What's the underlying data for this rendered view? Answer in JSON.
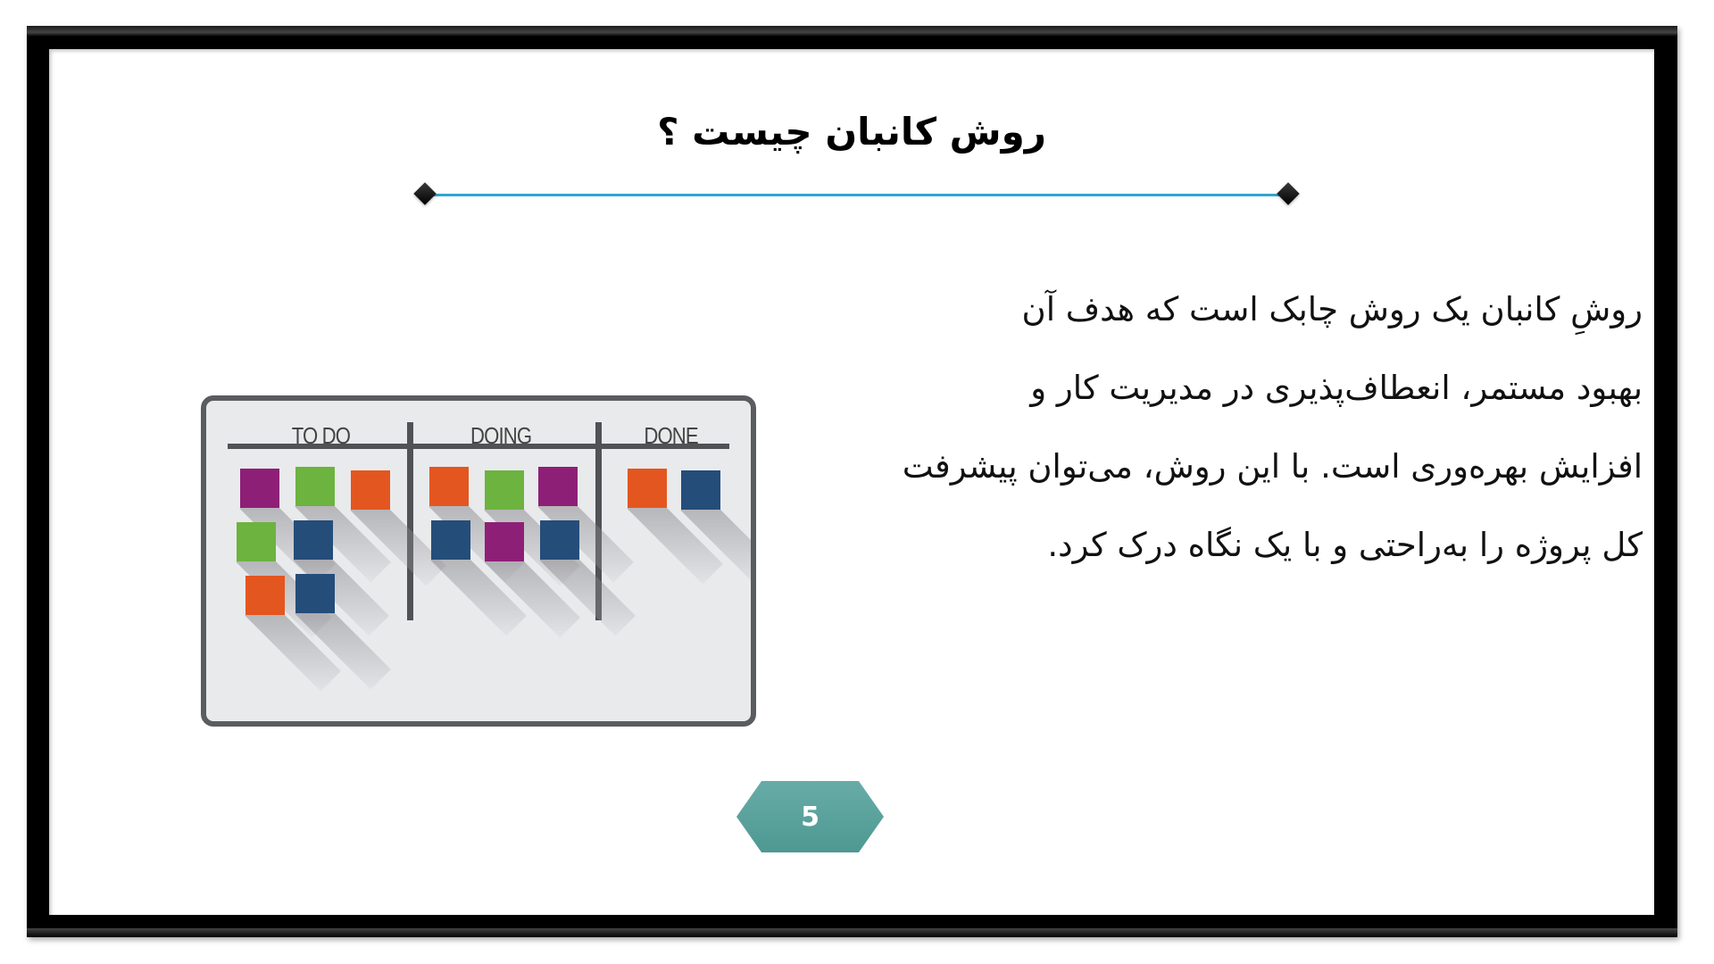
{
  "slide": {
    "title": "روش کانبان چیست ؟",
    "body_lines": [
      "روشِ کانبان یک روش چابک است که هدف آن",
      "بهبود مستمر، انعطاف‌پذیری در مدیریت کار و",
      "افزایش بهره‌وری است. با این روش، می‌توان پیشرفت",
      "کل پروژه را به‌راحتی و با یک نگاه درک کرد."
    ],
    "page_number": "5"
  },
  "kanban_board": {
    "columns": [
      {
        "label": "TO DO",
        "cards": [
          "purple",
          "green",
          "orange",
          "green",
          "blue",
          "orange",
          "blue"
        ]
      },
      {
        "label": "DOING",
        "cards": [
          "orange",
          "green",
          "purple",
          "blue",
          "purple",
          "blue"
        ]
      },
      {
        "label": "DONE",
        "cards": [
          "orange",
          "blue"
        ]
      }
    ]
  },
  "colors": {
    "accent_line": "#2fa5cf",
    "badge": "#5aa19c",
    "purple": "#8e1f77",
    "green": "#6db33f",
    "orange": "#e4561f",
    "blue": "#244d7a"
  }
}
